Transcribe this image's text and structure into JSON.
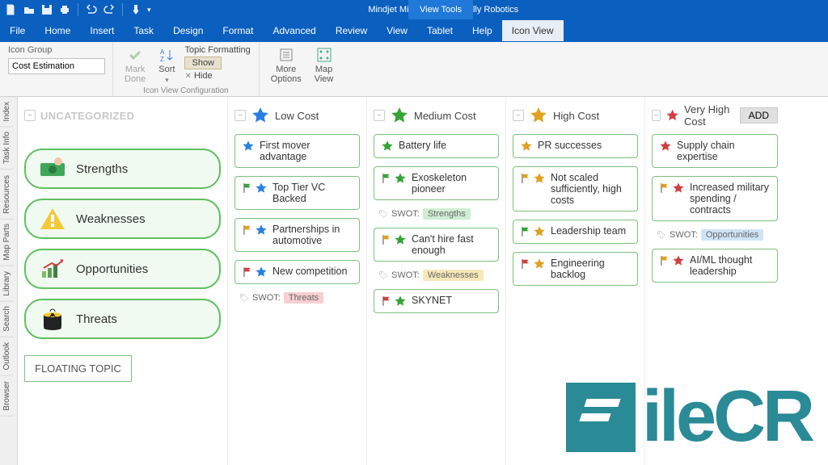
{
  "titlebar": {
    "title": "Mindjet MindManager - Rally Robotics",
    "viewtools": "View Tools"
  },
  "menu": {
    "file": "File",
    "home": "Home",
    "insert": "Insert",
    "task": "Task",
    "design": "Design",
    "format": "Format",
    "advanced": "Advanced",
    "review": "Review",
    "view": "View",
    "tablet": "Tablet",
    "help": "Help",
    "iconview": "Icon View"
  },
  "ribbon": {
    "icongroup_label": "Icon Group",
    "icongroup_value": "Cost Estimation",
    "markdone": "Mark\nDone",
    "sort": "Sort",
    "topicfmt": "Topic Formatting",
    "show": "Show",
    "hide": "Hide",
    "config_caption": "Icon View Configuration",
    "moreoptions": "More\nOptions",
    "mapview": "Map\nView"
  },
  "siderail": {
    "index": "Index",
    "taskinfo": "Task Info",
    "resources": "Resources",
    "mapparts": "Map Parts",
    "library": "Library",
    "search": "Search",
    "outlook": "Outlook",
    "browser": "Browser"
  },
  "columns": {
    "uncategorized": "UNCATEGORIZED",
    "low": "Low Cost",
    "medium": "Medium Cost",
    "high": "High Cost",
    "veryhigh": "Very High Cost",
    "add": "ADD"
  },
  "swot": {
    "strengths": "Strengths",
    "weaknesses": "Weaknesses",
    "opportunities": "Opportunities",
    "threats": "Threats",
    "floating": "FLOATING TOPIC"
  },
  "cards": {
    "low": [
      {
        "text": "First mover advantage"
      },
      {
        "text": "Top Tier VC Backed"
      },
      {
        "text": "Partnerships in automotive"
      },
      {
        "text": "New competition",
        "tag": {
          "label": "SWOT:",
          "value": "Threats",
          "bg": "#f7cfcf"
        }
      }
    ],
    "medium": [
      {
        "text": "Battery life"
      },
      {
        "text": "Exoskeleton pioneer",
        "tag": {
          "label": "SWOT:",
          "value": "Strengths",
          "bg": "#cfeed2"
        }
      },
      {
        "text": "Can't hire fast enough",
        "tag": {
          "label": "SWOT:",
          "value": "Weaknesses",
          "bg": "#f6e8b8"
        }
      },
      {
        "text": "SKYNET"
      }
    ],
    "high": [
      {
        "text": "PR successes"
      },
      {
        "text": "Not scaled sufficiently, high costs"
      },
      {
        "text": "Leadership team"
      },
      {
        "text": "Engineering backlog"
      }
    ],
    "veryhigh": [
      {
        "text": "Supply chain expertise"
      },
      {
        "text": "Increased military spending / contracts",
        "tag": {
          "label": "SWOT:",
          "value": "Opportunities",
          "bg": "#cfe3f7"
        }
      },
      {
        "text": "AI/ML thought leadership"
      }
    ]
  },
  "icons": {
    "low": [
      [
        "star",
        "#2a7fe0"
      ],
      [
        "flag",
        "#35a335",
        "star",
        "#2a7fe0"
      ],
      [
        "flag",
        "#e0a020",
        "star",
        "#2a7fe0"
      ],
      [
        "flag",
        "#d04040",
        "star",
        "#2a7fe0"
      ]
    ],
    "medium": [
      [
        "star",
        "#35a335"
      ],
      [
        "flag",
        "#35a335",
        "star",
        "#35a335"
      ],
      [
        "flag",
        "#e0a020",
        "star",
        "#35a335"
      ],
      [
        "flag",
        "#d04040",
        "star",
        "#35a335"
      ]
    ],
    "high": [
      [
        "star",
        "#e0a020"
      ],
      [
        "flag",
        "#e0a020",
        "star",
        "#e0a020"
      ],
      [
        "flag",
        "#35a335",
        "star",
        "#e0a020"
      ],
      [
        "flag",
        "#d04040",
        "star",
        "#e0a020"
      ]
    ],
    "veryhigh": [
      [
        "star",
        "#d04040"
      ],
      [
        "flag",
        "#e0a020",
        "star",
        "#d04040"
      ],
      [
        "flag",
        "#e0a020",
        "star",
        "#d04040"
      ]
    ]
  },
  "headstars": {
    "low": "#2a7fe0",
    "medium": "#35a335",
    "high": "#e0a020",
    "veryhigh": "#d04040"
  },
  "watermark": "ileCR"
}
